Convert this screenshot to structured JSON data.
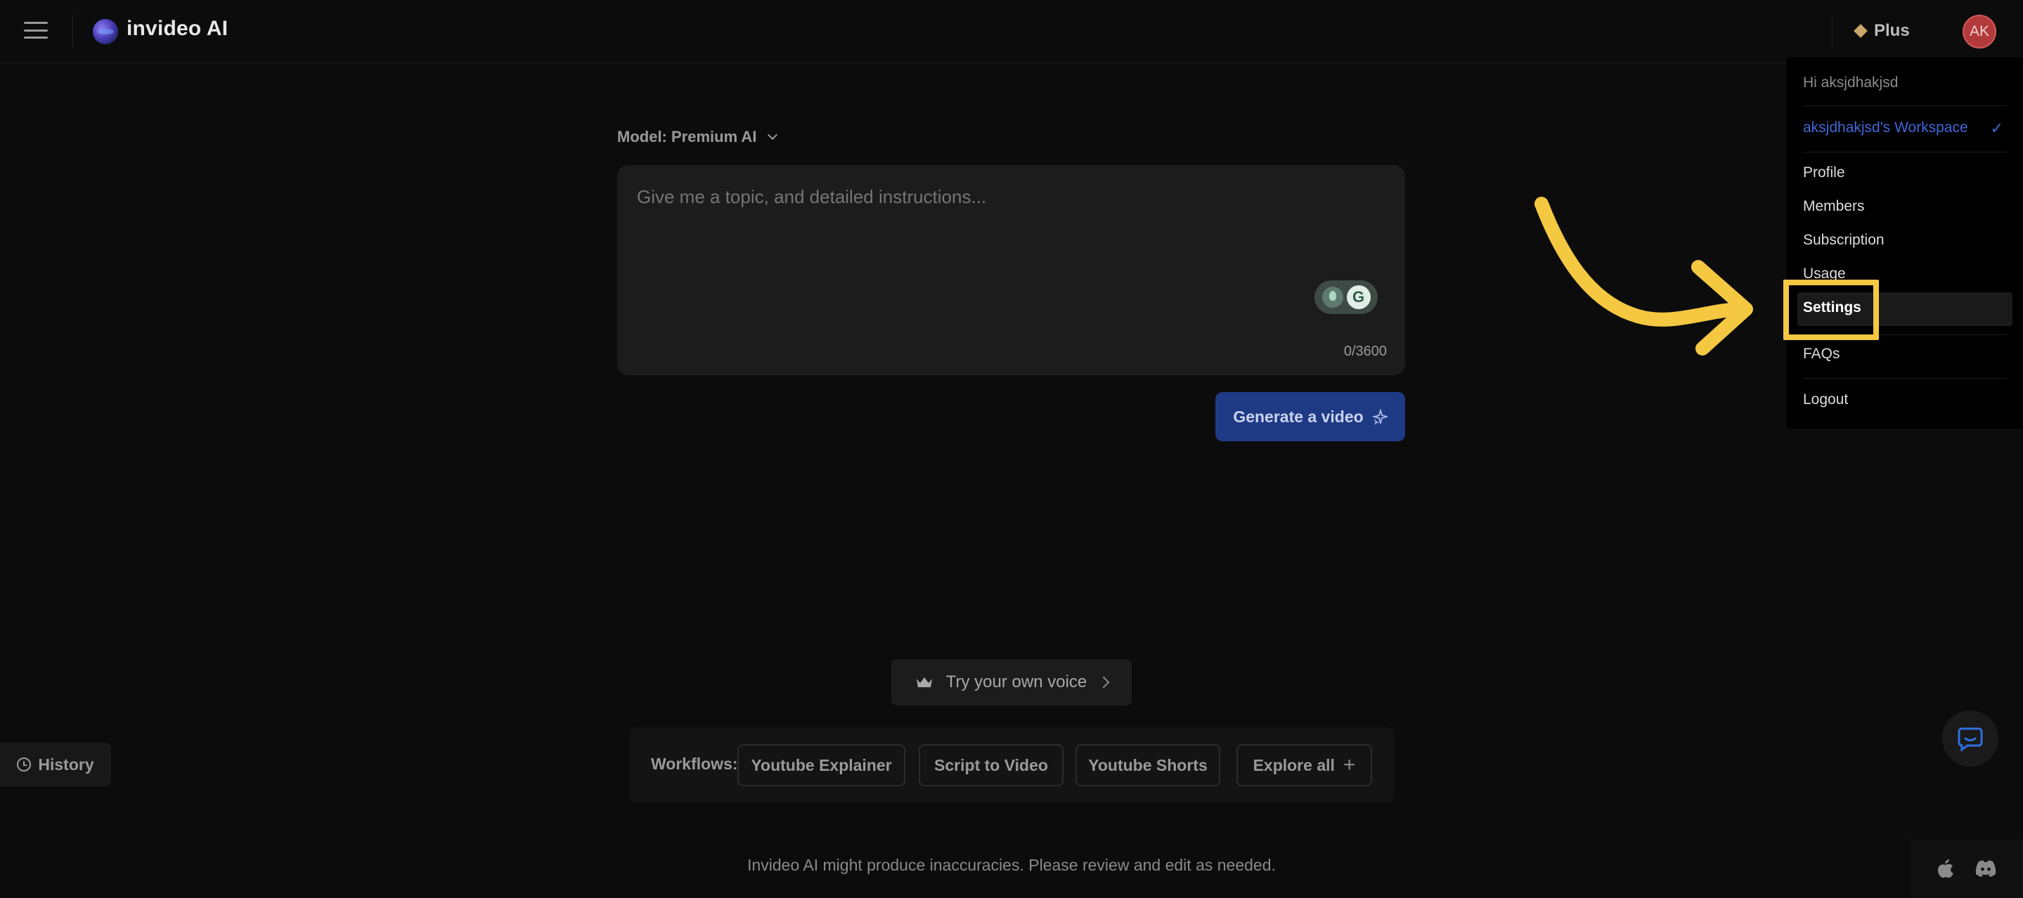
{
  "header": {
    "brand": "invideo AI",
    "plan_label": "Plus",
    "avatar_initials": "AK"
  },
  "user_menu": {
    "greeting": "Hi aksjdhakjsd",
    "workspace": "aksjdhakjsd's Workspace",
    "workspace_check": "✓",
    "items": [
      {
        "label": "Profile"
      },
      {
        "label": "Members"
      },
      {
        "label": "Subscription"
      },
      {
        "label": "Usage"
      },
      {
        "label": "Settings"
      },
      {
        "label": "FAQs"
      },
      {
        "label": "Logout"
      }
    ],
    "highlighted_item": "Settings"
  },
  "composer": {
    "model_label": "Model: Premium AI",
    "placeholder": "Give me a topic, and detailed instructions...",
    "char_count": "0/3600",
    "generate_label": "Generate a video",
    "grammarly_letter": "G"
  },
  "voice": {
    "label": "Try your own voice"
  },
  "workflows": {
    "label": "Workflows:",
    "items": [
      {
        "label": "Youtube Explainer"
      },
      {
        "label": "Script to Video"
      },
      {
        "label": "Youtube Shorts"
      },
      {
        "label": "Explore all"
      }
    ]
  },
  "history": {
    "label": "History"
  },
  "footer": {
    "disclaimer": "Invideo AI might produce inaccuracies. Please review and edit as needed."
  },
  "colors": {
    "background": "#0c0c0c",
    "accent_blue": "#1f3a85",
    "workspace_blue": "#3f68d8",
    "annotation_yellow": "#f5c842",
    "avatar_red": "#b23a3a"
  },
  "icons": [
    "hamburger-icon",
    "logo-icon",
    "diamond-icon",
    "grammarly-icon",
    "sparkle-icon",
    "crown-icon",
    "chevron-right-icon",
    "plus-icon",
    "clock-icon",
    "chat-icon",
    "apple-icon",
    "discord-icon",
    "annotation-arrow"
  ]
}
